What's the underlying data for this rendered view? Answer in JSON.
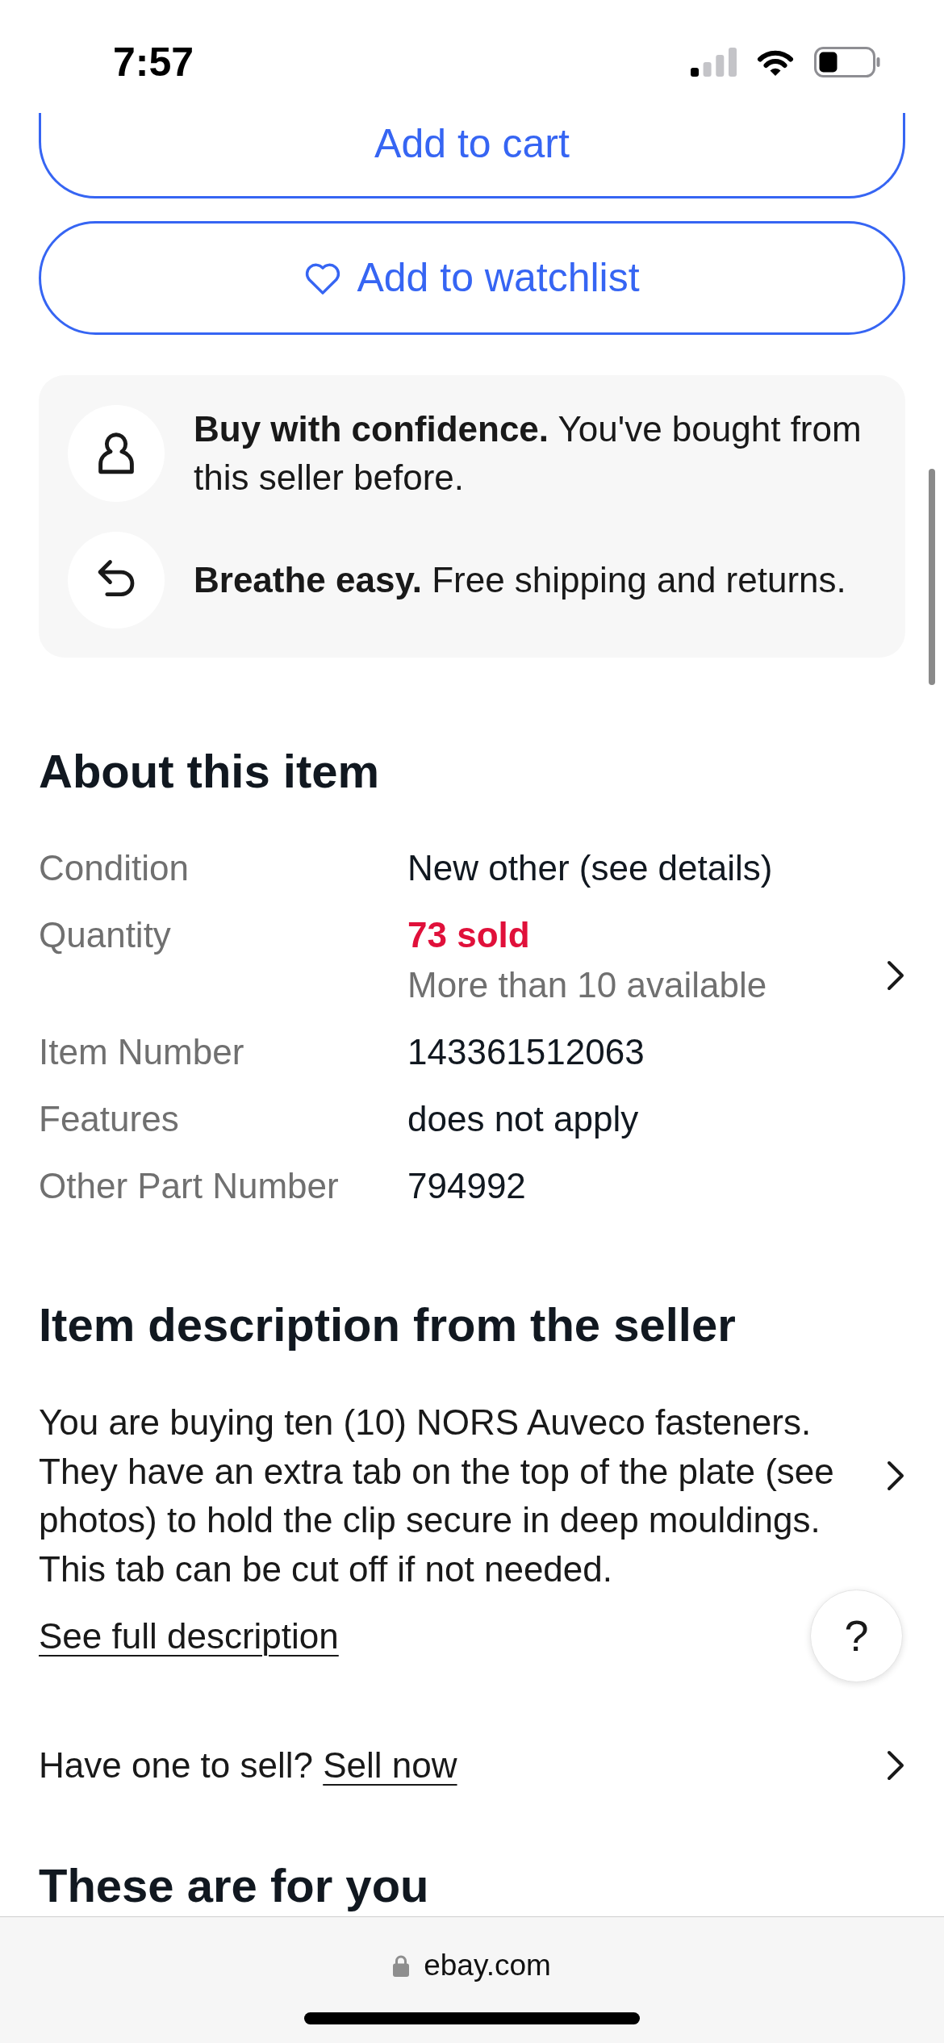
{
  "status_bar": {
    "time": "7:57"
  },
  "actions": [
    {
      "kind": "cart",
      "label": "Add to cart"
    },
    {
      "kind": "watchlist",
      "label": "Add to watchlist"
    }
  ],
  "assurances": [
    {
      "kind": "seller",
      "text": "**Buy with confidence.** You've bought from this seller before."
    },
    {
      "kind": "returns",
      "text": "**Breathe easy.** Free shipping and returns."
    }
  ],
  "about": {
    "title": "About this item",
    "rows": [
      {
        "kind": "spec",
        "label": "Condition",
        "value": "New other (see details)"
      },
      {
        "kind": "quantity",
        "label": "Quantity",
        "value": "73 sold",
        "note": "More than 10 available"
      },
      {
        "kind": "spec",
        "label": "Item Number",
        "value": "143361512063"
      },
      {
        "kind": "spec",
        "label": "Features",
        "value": "does not apply"
      },
      {
        "kind": "spec",
        "label": "Other Part Number",
        "value": "794992"
      }
    ]
  },
  "description": {
    "title": "Item description from the seller",
    "text": "You are buying ten (10) NORS Auveco fasteners. They have an extra tab on the top of the plate (see photos) to hold the clip secure in deep mouldings. This tab can be cut off if not needed.",
    "link": "See full description"
  },
  "help_button": {
    "label": "?"
  },
  "sell": {
    "prompt": "Have one to sell?",
    "link": "Sell now"
  },
  "recommendations": {
    "title": "These are for you"
  },
  "browser_bar": {
    "url": "ebay.com"
  }
}
